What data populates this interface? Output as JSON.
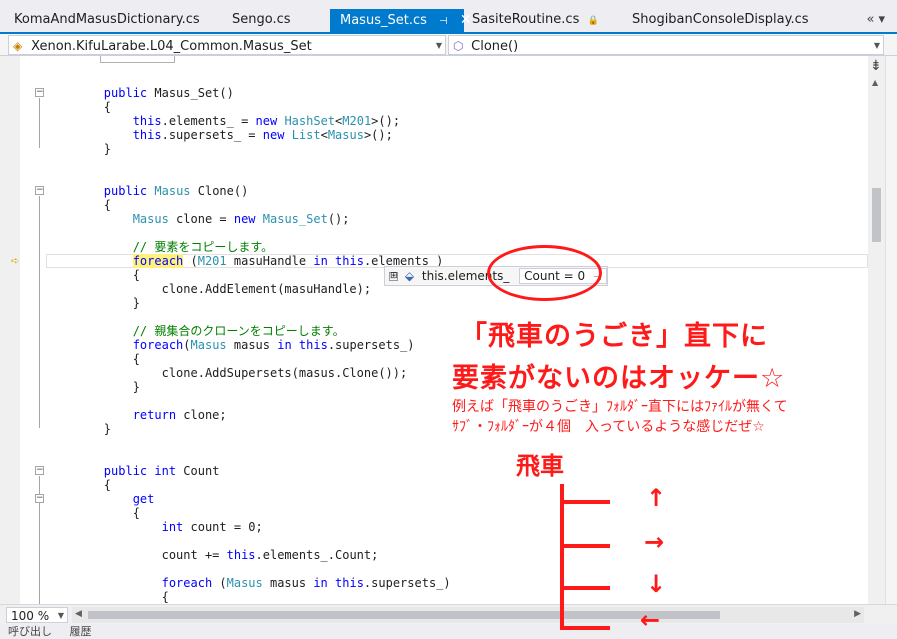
{
  "tabs": [
    {
      "label": "KomaAndMasusDictionary.cs"
    },
    {
      "label": "Sengo.cs"
    },
    {
      "label": "Masus_Set.cs",
      "pin": "⊣",
      "close": "✕"
    },
    {
      "label": "SasiteRoutine.cs",
      "lock": "🔒"
    },
    {
      "label": "ShogibanConsoleDisplay.cs"
    }
  ],
  "tab_overflow": "«▾",
  "nav": {
    "type_combo": "Xenon.KifuLarabe.L04_Common.Masus_Set",
    "member_combo": "Clone()"
  },
  "code": {
    "l1": {
      "t1": "        ",
      "k1": "public",
      "t2": " Masus_Set()"
    },
    "l2": "        {",
    "l3": {
      "t1": "            ",
      "k1": "this",
      "t2": ".elements_ = ",
      "k2": "new",
      "t3": " ",
      "y1": "HashSet",
      "t4": "<",
      "y2": "M201",
      "t5": ">();"
    },
    "l4": {
      "t1": "            ",
      "k1": "this",
      "t2": ".supersets_ = ",
      "k2": "new",
      "t3": " ",
      "y1": "List",
      "t4": "<",
      "y2": "Masus",
      "t5": ">();"
    },
    "l5": "        }",
    "l6": {
      "t1": "        ",
      "k1": "public",
      "t2": " ",
      "y1": "Masus",
      "t3": " Clone()"
    },
    "l7": "        {",
    "l8": {
      "t1": "            ",
      "y1": "Masus",
      "t2": " clone = ",
      "k1": "new",
      "t3": " ",
      "y2": "Masus_Set",
      "t4": "();"
    },
    "l9": "            // 要素をコピーします。",
    "l10": {
      "t1": "            ",
      "k1": "foreach",
      "t2": " (",
      "y1": "M201",
      "t3": " masuHandle ",
      "k2": "in",
      "t4": " ",
      "k3": "this",
      "t5": ".elements_)"
    },
    "l11": "            {",
    "l12": "                clone.AddElement(masuHandle);",
    "l13": "            }",
    "l14": "            // 親集合のクローンをコピーします。",
    "l15": {
      "t1": "            ",
      "k1": "foreach",
      "t2": "(",
      "y1": "Masus",
      "t3": " masus ",
      "k2": "in",
      "t4": " ",
      "k3": "this",
      "t5": ".supersets_)"
    },
    "l16": "            {",
    "l17": "                clone.AddSupersets(masus.Clone());",
    "l18": "            }",
    "l19": {
      "t1": "            ",
      "k1": "return",
      "t2": " clone;"
    },
    "l20": "        }",
    "l21": {
      "t1": "        ",
      "k1": "public",
      "t2": " ",
      "k2": "int",
      "t3": " Count"
    },
    "l22": "        {",
    "l23": {
      "t1": "            ",
      "k1": "get"
    },
    "l24": "            {",
    "l25": {
      "t1": "                ",
      "k1": "int",
      "t2": " count = 0;"
    },
    "l26": {
      "t1": "                count += ",
      "k1": "this",
      "t2": ".elements_.Count;"
    },
    "l27": {
      "t1": "                ",
      "k1": "foreach",
      "t2": " (",
      "y1": "Masus",
      "t3": " masus ",
      "k2": "in",
      "t4": " ",
      "k3": "this",
      "t5": ".supersets_)"
    },
    "l28": "                {"
  },
  "datatip": {
    "expand": "⊞",
    "name": "this.elements_",
    "value": "Count = 0",
    "pin": "⊣"
  },
  "annotation": {
    "line1": "「飛車のうごき」直下に",
    "line2": "要素がないのはオッケー☆",
    "line3": "例えば「飛車のうごき」ﾌｫﾙﾀﾞｰ直下にはﾌｧｲﾙが無くて",
    "line4": "ｻﾌﾞ・ﾌｫﾙﾀﾞｰが４個　入っているような感じだぜ☆",
    "tree_title": "飛車",
    "arrows": [
      "↑",
      "→",
      "↓",
      "←"
    ]
  },
  "bottom": {
    "zoom": "100 %",
    "status_items": [
      "呼び出し",
      "履歴"
    ]
  },
  "colors": {
    "accent": "#007acc",
    "annotation_red": "#ff1a1a",
    "keyword": "#0000ff",
    "type": "#2b91af",
    "comment": "#008000"
  }
}
